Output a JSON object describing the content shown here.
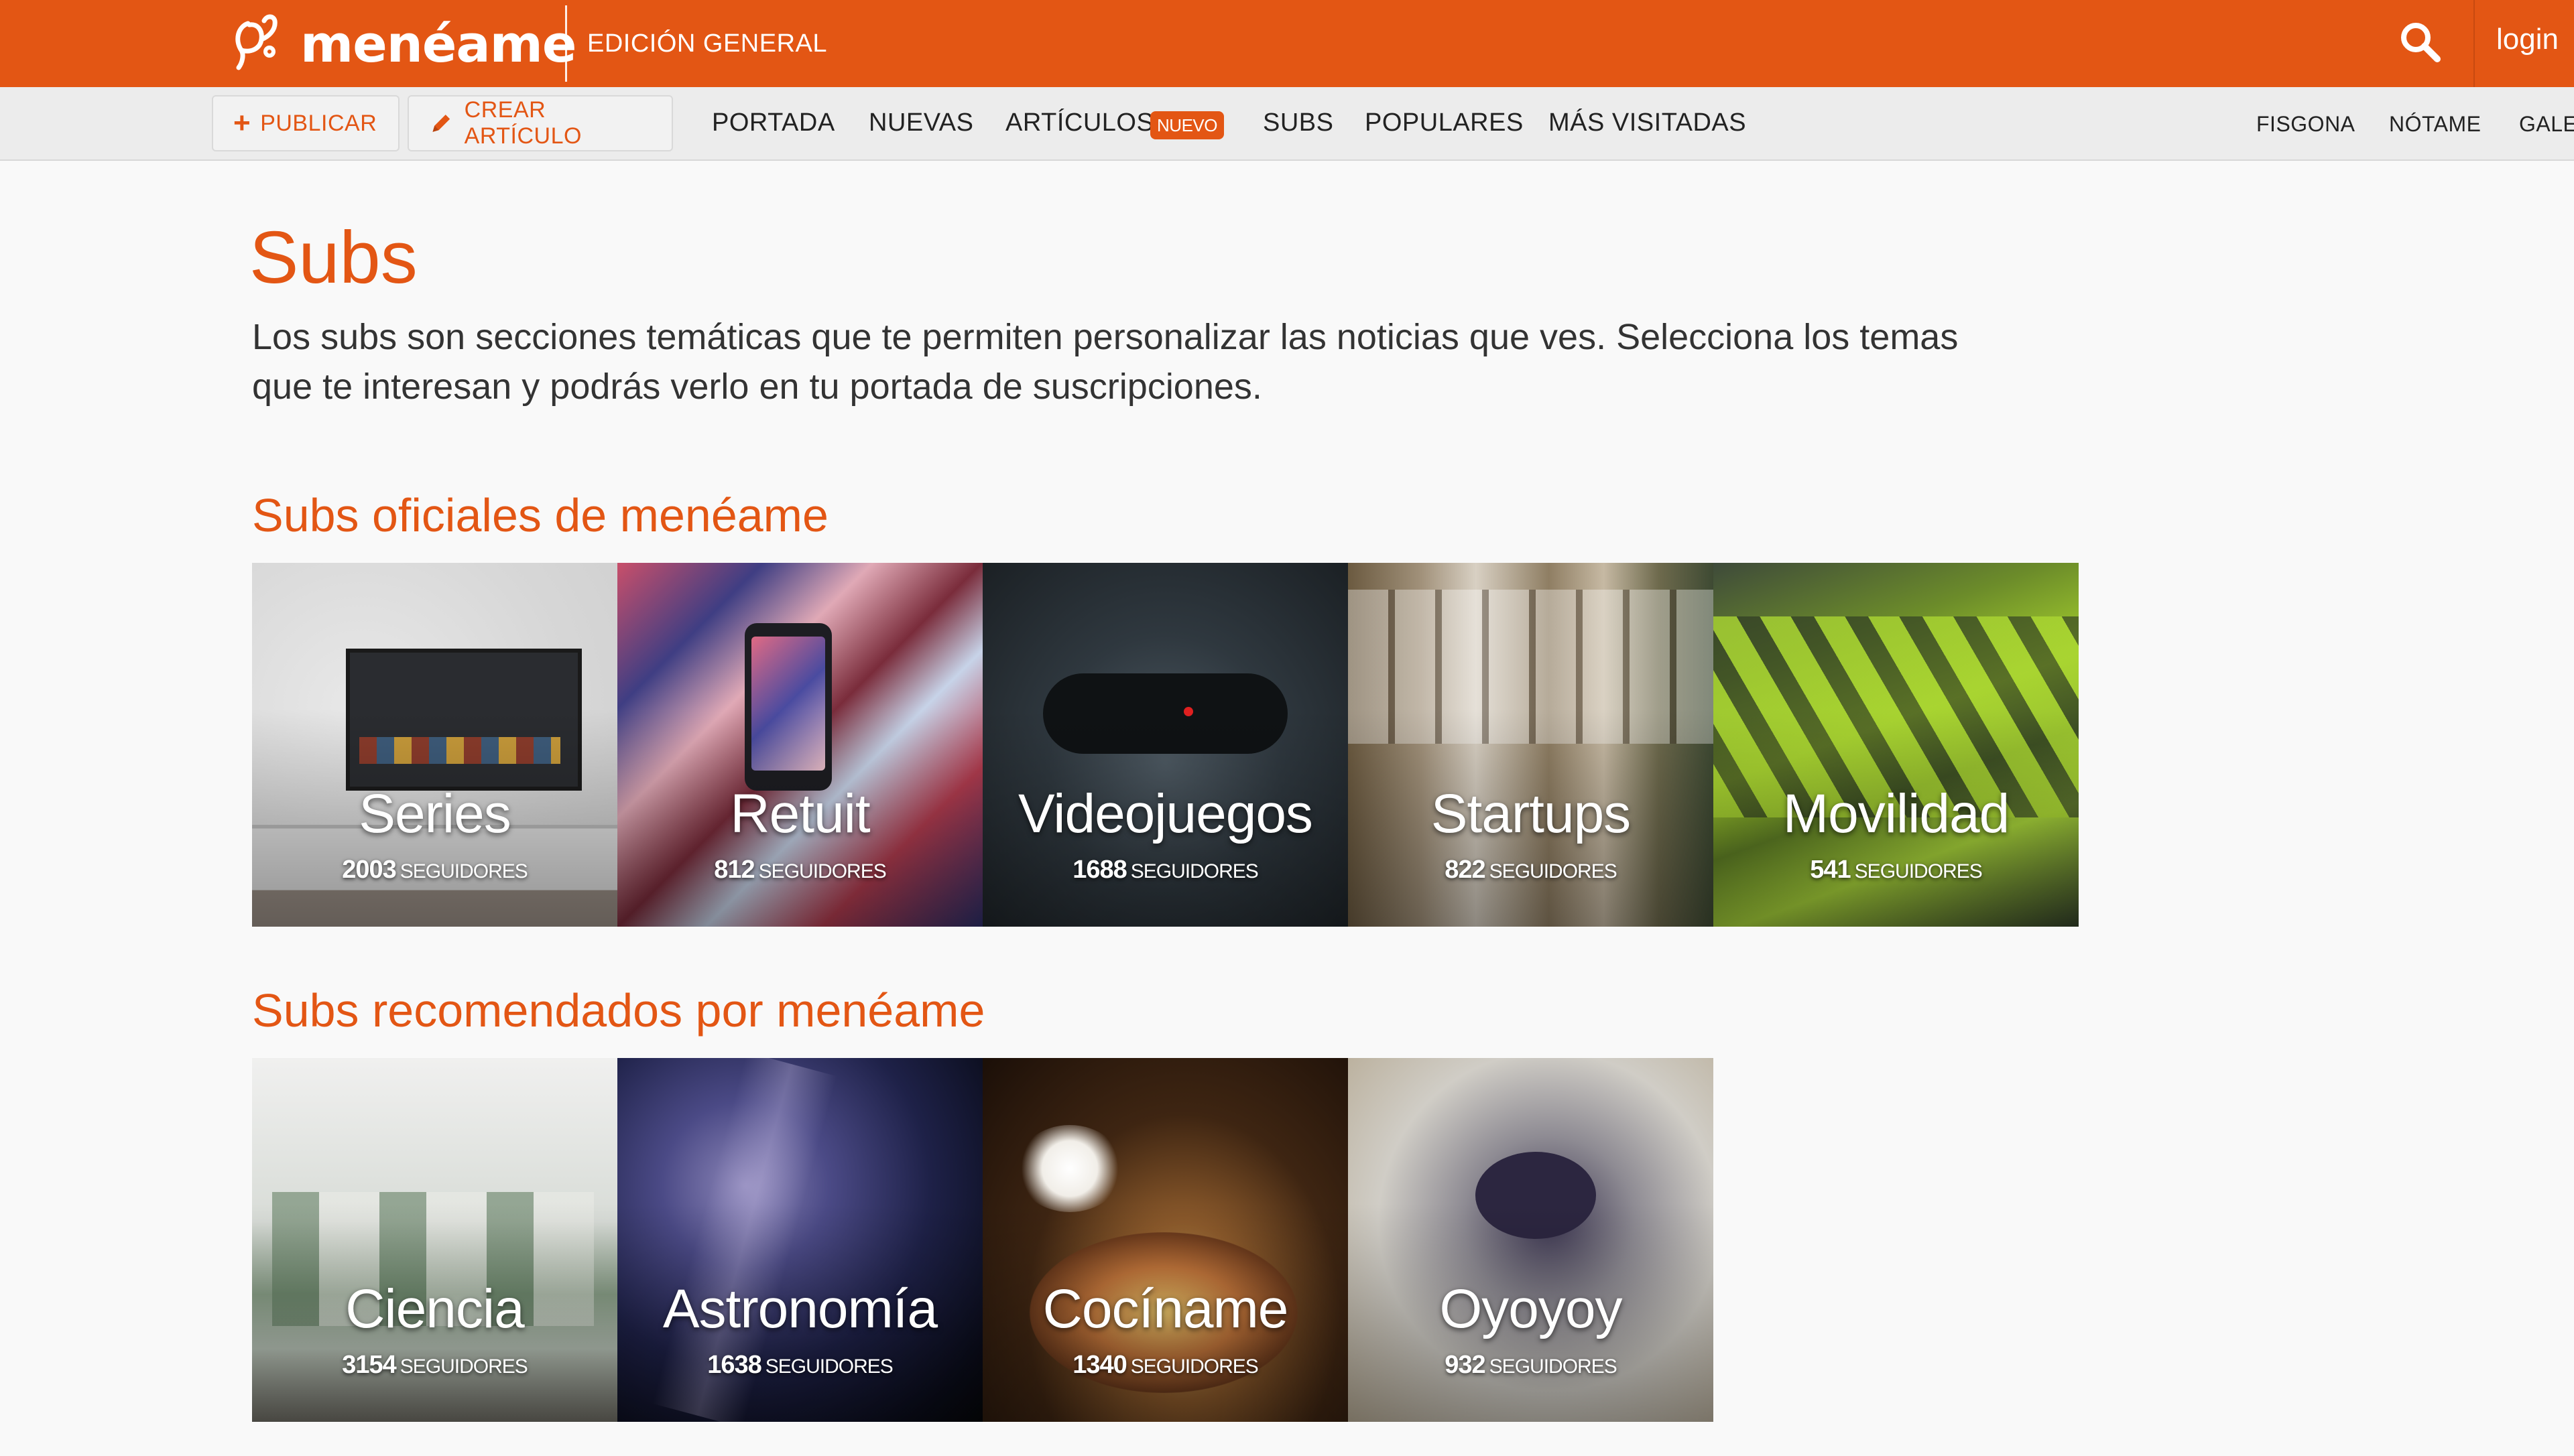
{
  "header": {
    "logo_text": "menéame",
    "edition": "EDICIÓN GENERAL",
    "login": "login"
  },
  "navbar": {
    "publish_label": "PUBLICAR",
    "create_article_label": "CREAR ARTÍCULO",
    "links": {
      "portada": "PORTADA",
      "nuevas": "NUEVAS",
      "articulos": "ARTÍCULOS",
      "articulos_badge": "NUEVO",
      "subs": "SUBS",
      "populares": "POPULARES",
      "mas_visitadas": "MÁS VISITADAS"
    },
    "right_links": {
      "fisgona": "FISGONA",
      "notame": "NÓTAME",
      "gale": "GALE"
    }
  },
  "main": {
    "title": "Subs",
    "intro": "Los subs son secciones temáticas que te permiten personalizar las noticias que ves. Selecciona los temas que te interesan y podrás verlo en tu portada de suscripciones.",
    "official": {
      "title": "Subs oficiales de menéame",
      "items": [
        {
          "name": "Series",
          "followers": "2003",
          "label": "SEGUIDORES"
        },
        {
          "name": "Retuit",
          "followers": "812",
          "label": "SEGUIDORES"
        },
        {
          "name": "Videojuegos",
          "followers": "1688",
          "label": "SEGUIDORES"
        },
        {
          "name": "Startups",
          "followers": "822",
          "label": "SEGUIDORES"
        },
        {
          "name": "Movilidad",
          "followers": "541",
          "label": "SEGUIDORES"
        }
      ]
    },
    "recommended": {
      "title": "Subs recomendados por menéame",
      "items": [
        {
          "name": "Ciencia",
          "followers": "3154",
          "label": "SEGUIDORES"
        },
        {
          "name": "Astronomía",
          "followers": "1638",
          "label": "SEGUIDORES"
        },
        {
          "name": "Cocíname",
          "followers": "1340",
          "label": "SEGUIDORES"
        },
        {
          "name": "Oyoyoy",
          "followers": "932",
          "label": "SEGUIDORES"
        }
      ]
    }
  },
  "colors": {
    "brand_orange": "#e35614",
    "nav_bg": "#ececec",
    "page_bg": "#f9f9f9"
  }
}
